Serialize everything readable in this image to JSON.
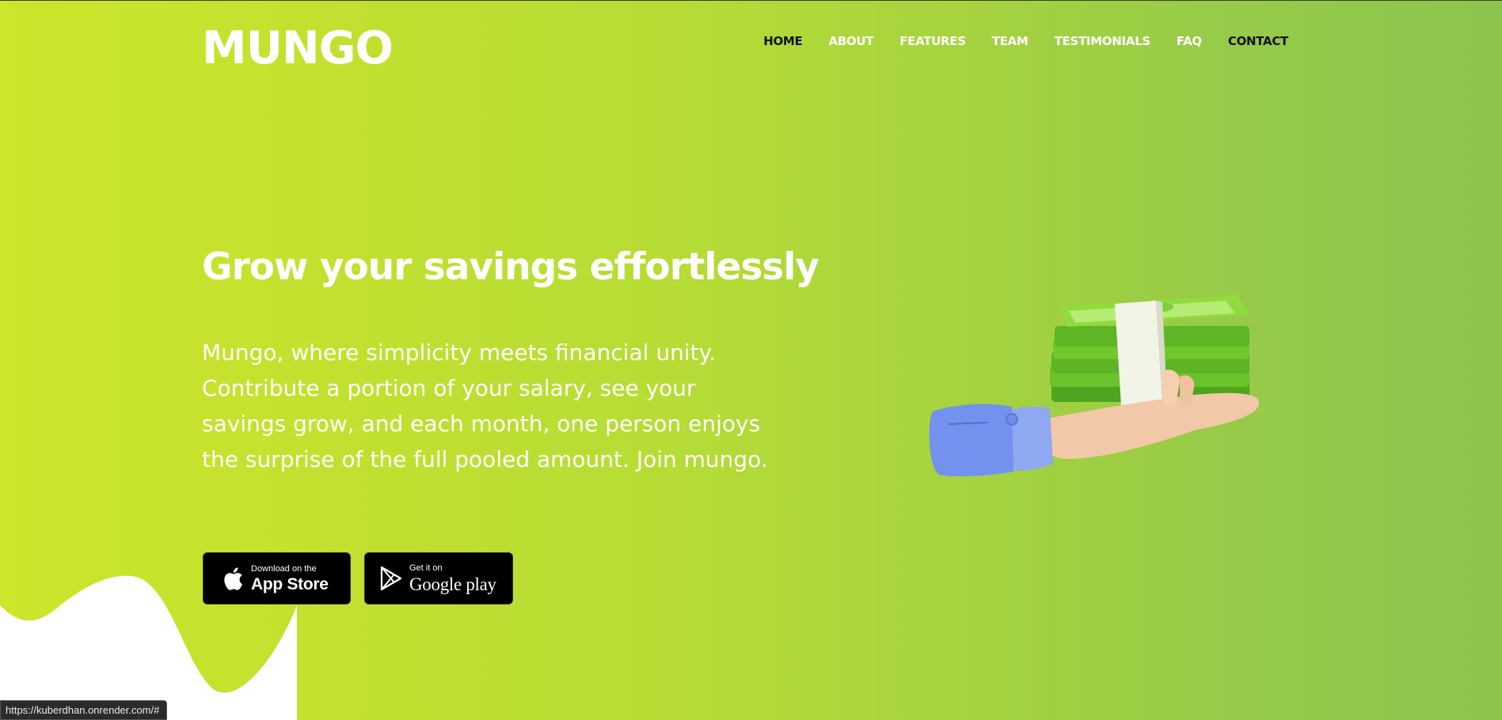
{
  "brand": {
    "logo_text": "MUNGO"
  },
  "nav": {
    "items": [
      {
        "label": "HOME"
      },
      {
        "label": "ABOUT"
      },
      {
        "label": "FEATURES"
      },
      {
        "label": "TEAM"
      },
      {
        "label": "TESTIMONIALS"
      },
      {
        "label": "FAQ"
      },
      {
        "label": "CONTACT"
      }
    ]
  },
  "hero": {
    "headline": "Grow your savings effortlessly",
    "description": "Mungo, where simplicity meets financial unity. Contribute a portion of your salary, see your savings grow, and each month, one person enjoys the surprise of the full pooled amount. Join mungo."
  },
  "buttons": {
    "app_store": {
      "small": "Download on the",
      "big": "App Store",
      "icon": "apple-icon"
    },
    "google_play": {
      "small": "Get it on",
      "big": "Google play",
      "icon": "play-store-icon"
    }
  },
  "illustration": {
    "icon": "hand-holding-money-icon"
  },
  "status_bar": {
    "url": "https://kuberdhan.onrender.com/#"
  },
  "colors": {
    "gradient_start": "#cde52a",
    "gradient_end": "#8cc44d",
    "text_light": "#ffffff",
    "text_dark": "#111111",
    "button_bg": "#000000"
  }
}
